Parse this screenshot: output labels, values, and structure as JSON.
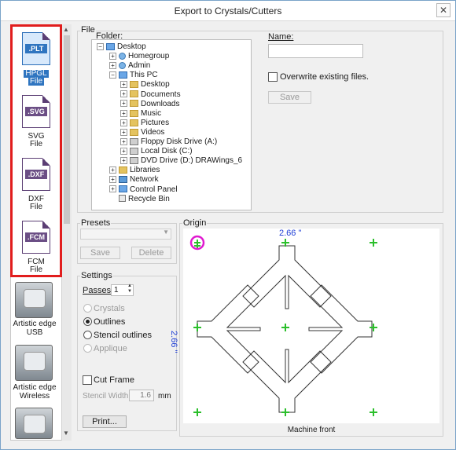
{
  "window": {
    "title": "Export to Crystals/Cutters",
    "close_glyph": "✕"
  },
  "formats": [
    {
      "tag": ".PLT",
      "label1": "HPGL",
      "label2": "File",
      "selected": true
    },
    {
      "tag": ".SVG",
      "label1": "SVG",
      "label2": "File",
      "selected": false
    },
    {
      "tag": ".DXF",
      "label1": "DXF",
      "label2": "File",
      "selected": false
    },
    {
      "tag": ".FCM",
      "label1": "FCM",
      "label2": "File",
      "selected": false
    }
  ],
  "devices": [
    {
      "label1": "Artistic edge",
      "label2": "USB"
    },
    {
      "label1": "Artistic edge",
      "label2": "Wireless"
    }
  ],
  "file_group": {
    "title": "File",
    "folder_label": "Folder:",
    "name_label": "Name:",
    "name_value": "",
    "overwrite_label": "Overwrite existing files.",
    "save_label": "Save"
  },
  "tree": [
    {
      "label": "Desktop",
      "icon": "pc",
      "exp": "−"
    },
    {
      "label": "Homegroup",
      "icon": "user",
      "exp": "+"
    },
    {
      "label": "Admin",
      "icon": "user",
      "exp": "+"
    },
    {
      "label": "This PC",
      "icon": "pc",
      "exp": "−"
    },
    {
      "label": "Desktop",
      "icon": "folder",
      "exp": "+"
    },
    {
      "label": "Documents",
      "icon": "folder",
      "exp": "+"
    },
    {
      "label": "Downloads",
      "icon": "folder",
      "exp": "+"
    },
    {
      "label": "Music",
      "icon": "folder",
      "exp": "+"
    },
    {
      "label": "Pictures",
      "icon": "folder",
      "exp": "+"
    },
    {
      "label": "Videos",
      "icon": "folder",
      "exp": "+"
    },
    {
      "label": "Floppy Disk Drive (A:)",
      "icon": "drive",
      "exp": "+"
    },
    {
      "label": "Local Disk (C:)",
      "icon": "drive",
      "exp": "+"
    },
    {
      "label": "DVD Drive (D:) DRAWings_6",
      "icon": "drive",
      "exp": "+"
    },
    {
      "label": "Libraries",
      "icon": "folder",
      "exp": "+"
    },
    {
      "label": "Network",
      "icon": "net",
      "exp": "+"
    },
    {
      "label": "Control Panel",
      "icon": "pc",
      "exp": "+"
    },
    {
      "label": "Recycle Bin",
      "icon": "bin",
      "exp": ""
    }
  ],
  "presets": {
    "title": "Presets",
    "value": "",
    "save_label": "Save",
    "delete_label": "Delete"
  },
  "settings": {
    "title": "Settings",
    "passes_label": "Passes:",
    "passes_value": "1",
    "options": [
      {
        "label": "Crystals",
        "checked": false,
        "disabled": true
      },
      {
        "label": "Outlines",
        "checked": true,
        "disabled": false
      },
      {
        "label": "Stencil outlines",
        "checked": false,
        "disabled": false
      },
      {
        "label": "Applique",
        "checked": false,
        "disabled": true
      }
    ],
    "cut_frame_label": "Cut Frame",
    "stencil_width_label": "Stencil Width :",
    "stencil_width_value": "1.6",
    "stencil_width_unit": "mm",
    "print_label": "Print..."
  },
  "origin": {
    "title": "Origin",
    "width_text": "2.66 \"",
    "height_text": "2.66 \"",
    "machine_front": "Machine front"
  },
  "colors": {
    "accent": "#2f75c0",
    "highlight_frame": "#e11d1d",
    "origin_marker": "#2bbf2b",
    "selected_origin": "#e01ad0",
    "dimension_text": "#1f3fd6"
  }
}
